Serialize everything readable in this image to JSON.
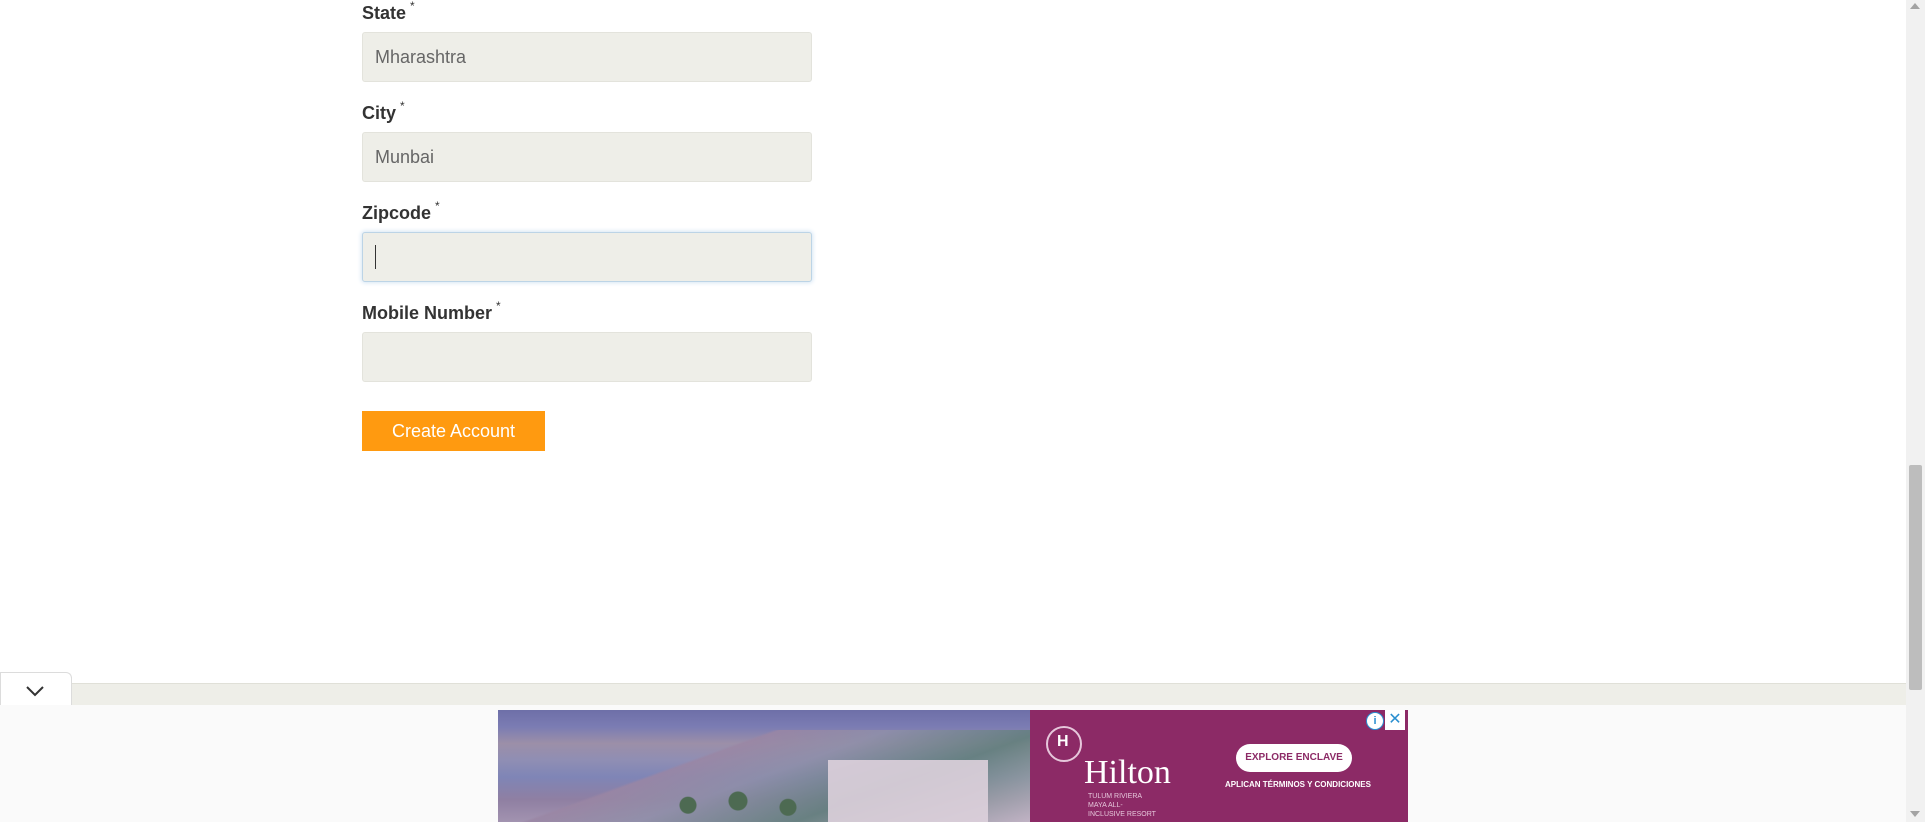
{
  "form": {
    "fields": [
      {
        "label": "State",
        "required_mark": "*",
        "value": "Mharashtra",
        "placeholder": ""
      },
      {
        "label": "City",
        "required_mark": "*",
        "value": "Munbai",
        "placeholder": ""
      },
      {
        "label": "Zipcode",
        "required_mark": "*",
        "value": "",
        "placeholder": ""
      },
      {
        "label": "Mobile Number",
        "required_mark": "*",
        "value": "",
        "placeholder": ""
      }
    ],
    "submit_label": "Create Account"
  },
  "ad": {
    "brand": "Hilton",
    "brand_mark": "H",
    "brand_sub": "TULUM RIVIERA MAYA ALL-INCLUSIVE RESORT",
    "cta": "EXPLORE ENCLAVE",
    "terms": "APLICAN TÉRMINOS Y CONDICIONES",
    "info_icon": "i",
    "close_icon": "✕"
  },
  "colors": {
    "accent": "#ff9a10",
    "input_bg": "#eeeee8",
    "ad_brand_bg": "#8c2a66"
  },
  "icons": [
    "chevron-down-icon",
    "info-icon",
    "close-icon",
    "scroll-up-arrow-icon",
    "scroll-down-arrow-icon"
  ]
}
